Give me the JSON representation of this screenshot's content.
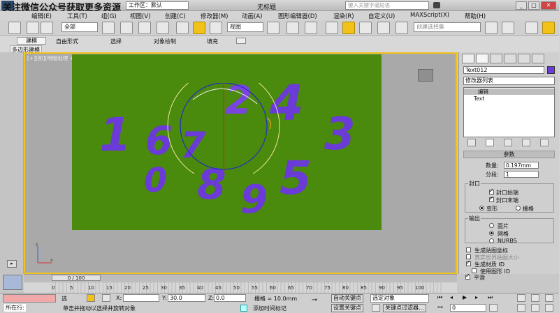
{
  "titlebar": {
    "overlay_text": "关注微信公众号获取更多资源",
    "workspace_label": "工作区：默认",
    "doc_title": "无标题",
    "search_placeholder": "键入关键字或短语"
  },
  "menu": [
    "编辑(E)",
    "工具(T)",
    "组(G)",
    "视图(V)",
    "创建(C)",
    "修改器(M)",
    "动画(A)",
    "图形编辑器(D)",
    "渲染(R)",
    "自定义(U)",
    "MAXScript(X)",
    "帮助(H)"
  ],
  "toolbar": {
    "selection_filter": "全部",
    "ref_coord": "视图",
    "named_selection": "创建选择集"
  },
  "ribbon_tabs": [
    "建模",
    "自由形式",
    "选择",
    "对象绘制",
    "填充"
  ],
  "ribbon_sub": "多边形建模",
  "viewport": {
    "label": "[+][前][明暗处理 + 边面]",
    "numbers": [
      "1",
      "6",
      "7",
      "2",
      "4",
      "3",
      "0",
      "8",
      "9",
      "5"
    ]
  },
  "right_panel": {
    "object_name": "Text012",
    "modifier_list": "修改器列表",
    "stack": [
      "编辑",
      "Text"
    ],
    "params_title": "参数",
    "steps_label": "数量:",
    "steps_value": "0.197mm",
    "segments_label": "分段:",
    "segments_value": "1",
    "capping_title": "封口",
    "cap_start": "封口始端",
    "cap_end": "封口末端",
    "morph": "变形",
    "grid": "栅格",
    "output_title": "输出",
    "out_patch": "面片",
    "out_mesh": "网格",
    "out_nurbs": "NURBS",
    "gen_map": "生成贴图坐标",
    "real_world": "真实世界贴图大小",
    "gen_matid": "生成材质 ID",
    "use_shape_id": "使用图形 ID",
    "smooth": "平滑"
  },
  "timeline": {
    "frame_display": "0 / 100",
    "ticks": [
      "0",
      "5",
      "10",
      "15",
      "20",
      "25",
      "30",
      "35",
      "40",
      "45",
      "50",
      "55",
      "60",
      "65",
      "70",
      "75",
      "80",
      "85",
      "90",
      "95",
      "100"
    ]
  },
  "status": {
    "location_label": "所在行:",
    "prompt": "单击并拖动以选择并旋转对象",
    "x_label": "X:",
    "y_label": "Y:",
    "y_value": "30.0",
    "z_label": "Z:",
    "z_value": "0.0",
    "grid": "栅格 = 10.0mm",
    "add_time_tag": "添加时间标记",
    "auto_key": "自动关键点",
    "set_key": "设置关键点",
    "selected_object": "选定对象",
    "key_filter": "关键点过滤器...",
    "frame_value": "0",
    "sel_label": "选"
  },
  "colors": {
    "viewport_green": "#4a8a0c",
    "number_purple": "#6a3bd6",
    "active_yellow": "#f2c21a"
  }
}
